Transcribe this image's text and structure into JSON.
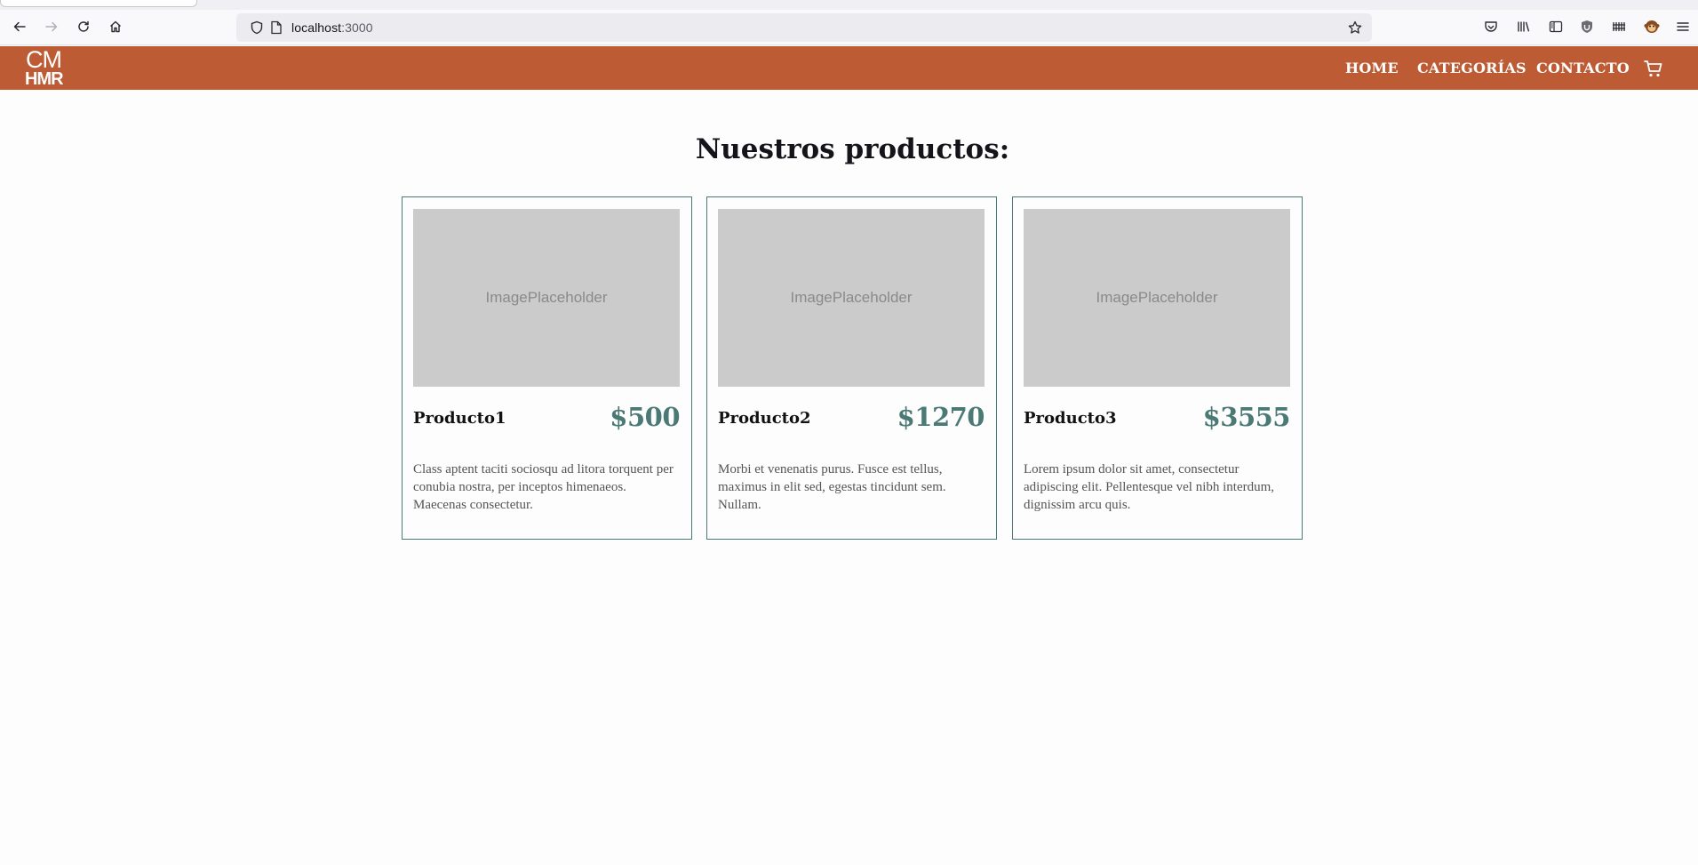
{
  "browser": {
    "url_host": "localhost",
    "url_port": ":3000",
    "icons": [
      "back-icon",
      "forward-icon",
      "reload-icon",
      "home-icon",
      "shield-icon",
      "page-icon",
      "bookmark-star-icon",
      "pocket-icon",
      "library-icon",
      "sidebar-icon",
      "ublock-icon",
      "extension-icon",
      "monkey-icon",
      "menu-icon"
    ]
  },
  "site": {
    "logo_line1": "CM",
    "logo_line2": "HMR",
    "nav": [
      "HOME",
      "CATEGORÍAS",
      "CONTACTO"
    ],
    "header_color": "#bd5b34",
    "accent_color": "#4b7a76"
  },
  "main": {
    "title": "Nuestros productos:",
    "products": [
      {
        "image_label": "ImagePlaceholder",
        "name": "Producto1",
        "price": "$500",
        "description": "Class aptent taciti sociosqu ad litora torquent per conubia nostra, per inceptos himenaeos. Maecenas consectetur."
      },
      {
        "image_label": "ImagePlaceholder",
        "name": "Producto2",
        "price": "$1270",
        "description": "Morbi et venenatis purus. Fusce est tellus, maximus in elit sed, egestas tincidunt sem. Nullam."
      },
      {
        "image_label": "ImagePlaceholder",
        "name": "Producto3",
        "price": "$3555",
        "description": "Lorem ipsum dolor sit amet, consectetur adipiscing elit. Pellentesque vel nibh interdum, dignissim arcu quis."
      }
    ]
  }
}
